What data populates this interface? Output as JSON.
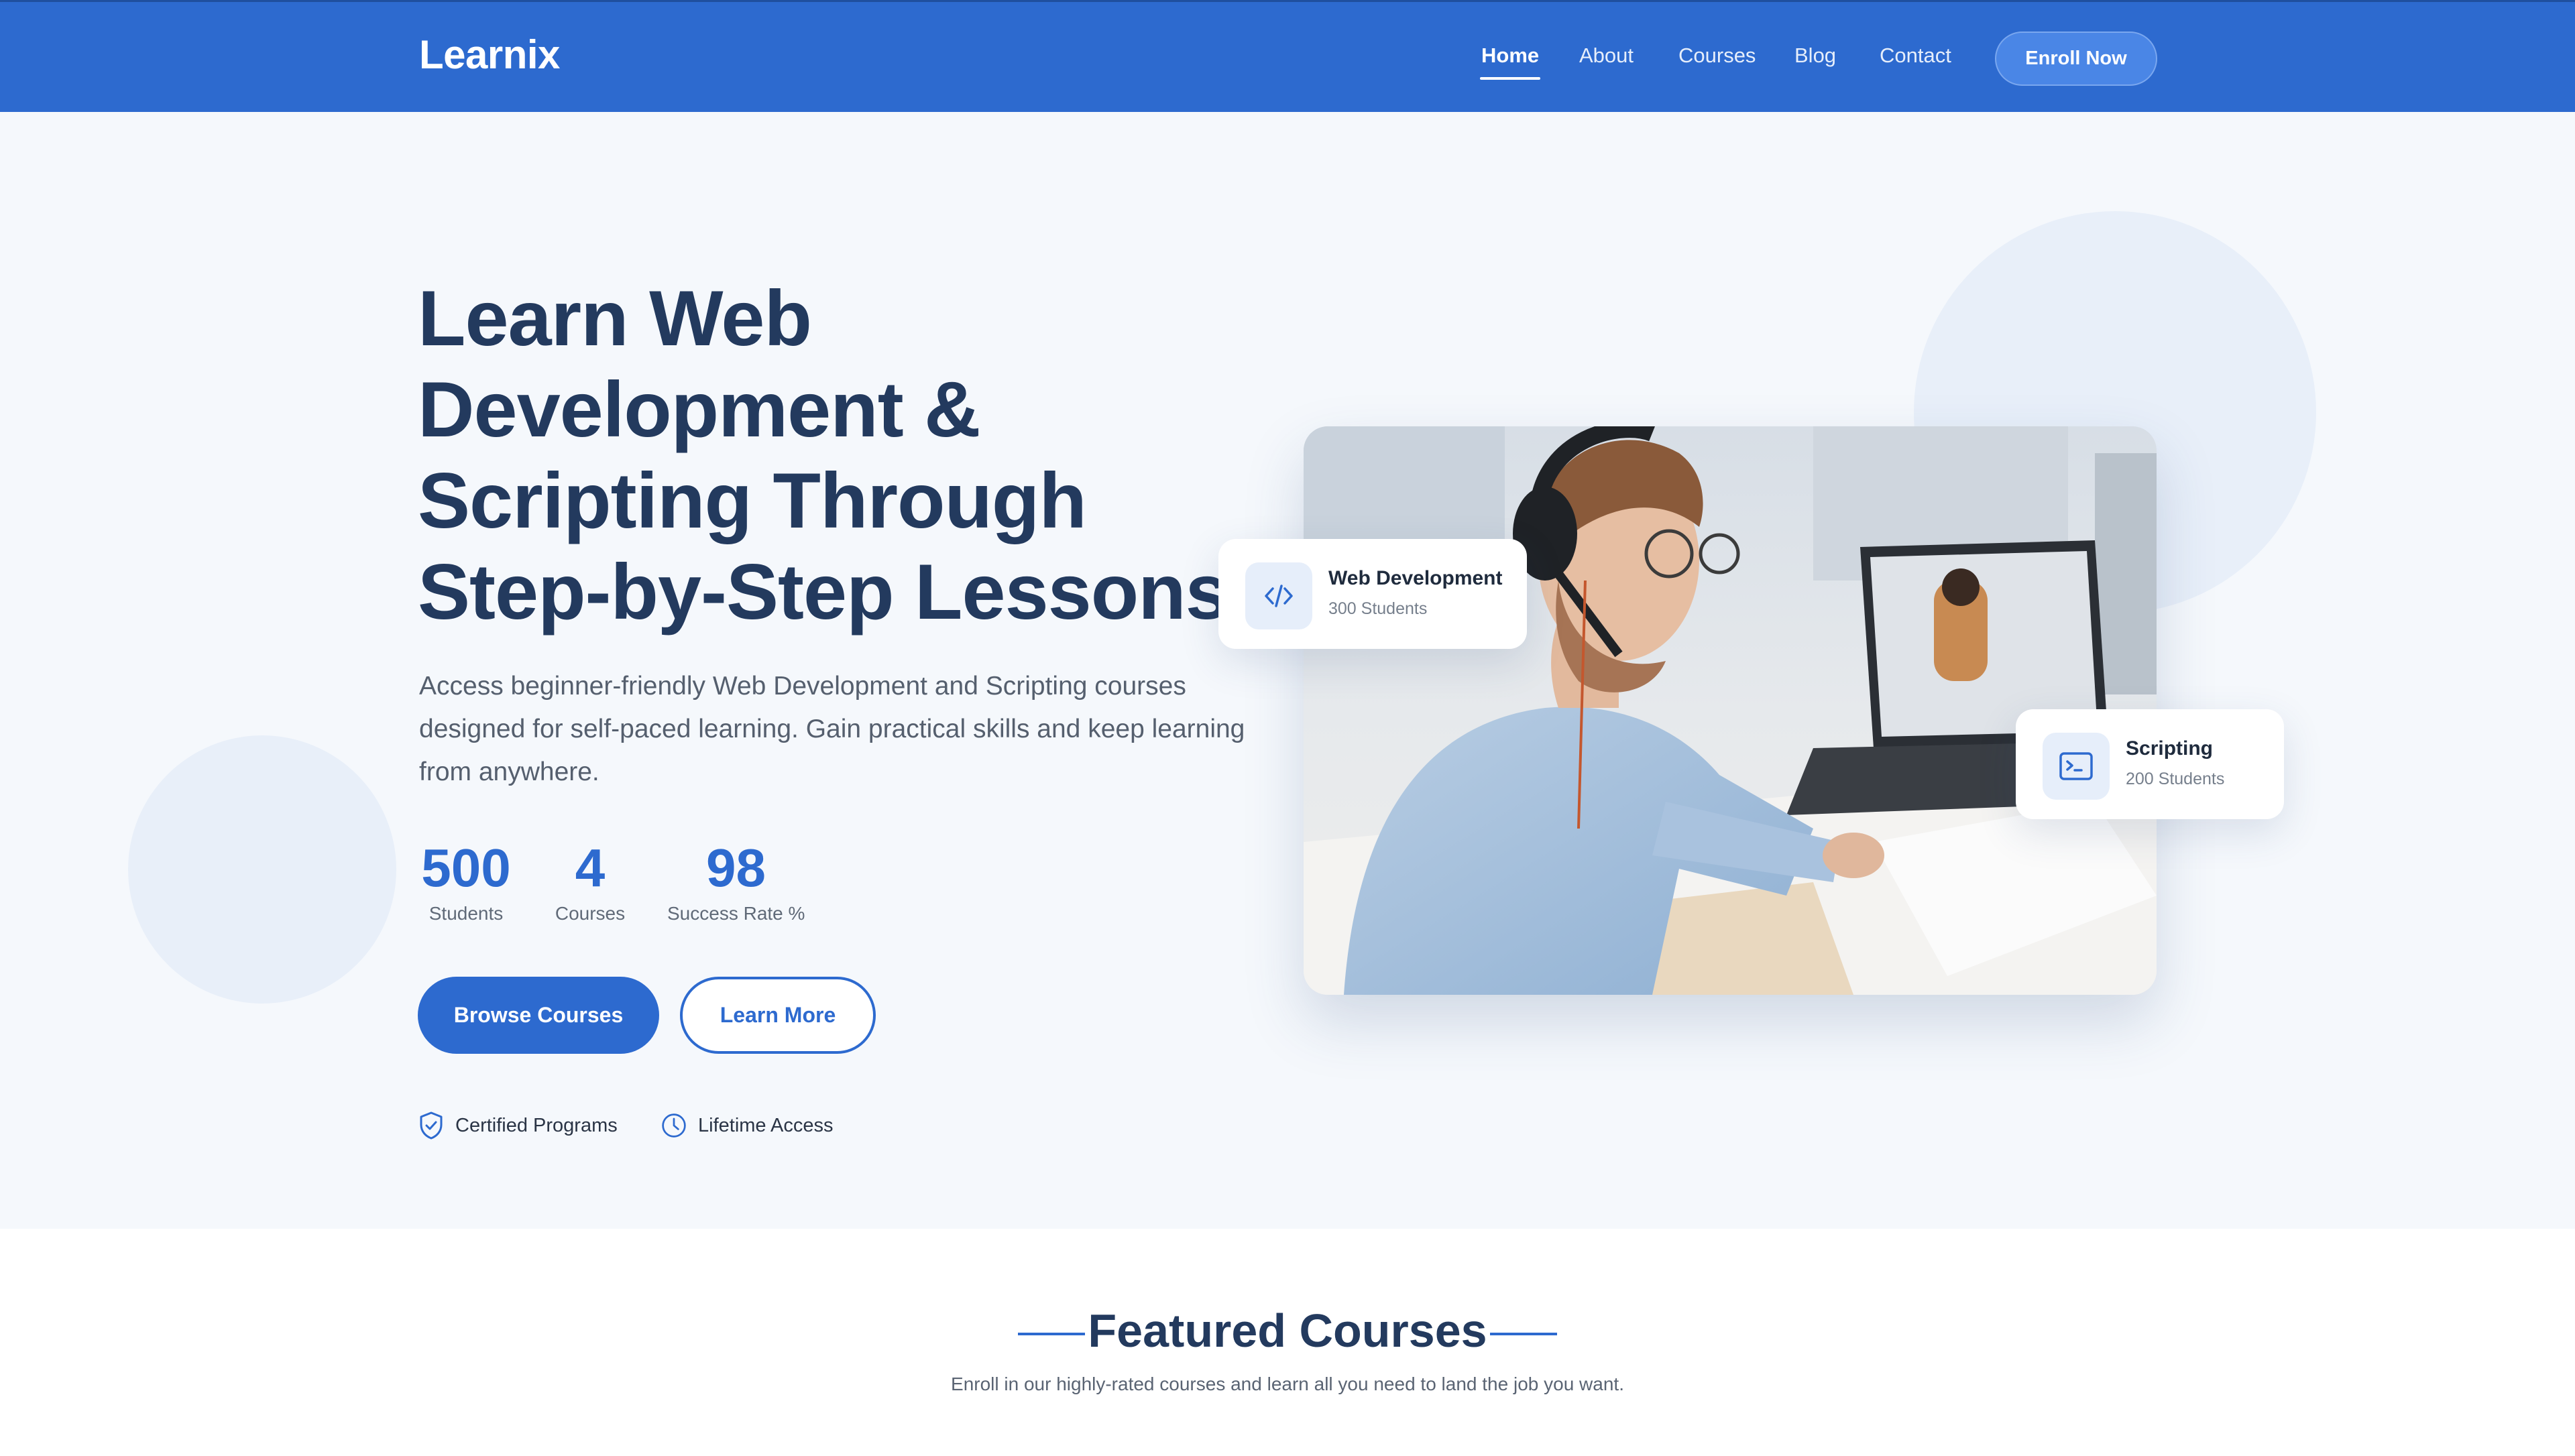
{
  "header": {
    "logo": "Learnix",
    "nav": [
      "Home",
      "About",
      "Courses",
      "Blog",
      "Contact"
    ],
    "active_nav": "Home",
    "cta": "Enroll Now"
  },
  "hero": {
    "title_lines": [
      "Learn Web",
      "Development &",
      "Scripting Through",
      "Step-by-Step Lessons"
    ],
    "description": "Access beginner-friendly Web Development and Scripting courses designed for self-paced learning. Gain practical skills and keep learning from anywhere.",
    "stats": [
      {
        "value": "500",
        "label": "Students"
      },
      {
        "value": "4",
        "label": "Courses"
      },
      {
        "value": "98",
        "label": "Success Rate %"
      }
    ],
    "primary_button": "Browse Courses",
    "secondary_button": "Learn More",
    "features": [
      {
        "label": "Certified Programs",
        "icon": "shield-check-icon"
      },
      {
        "label": "Lifetime Access",
        "icon": "clock-icon"
      }
    ],
    "cards": [
      {
        "title": "Web Development",
        "subtitle": "300 Students",
        "icon": "code-icon"
      },
      {
        "title": "Scripting",
        "subtitle": "200 Students",
        "icon": "terminal-icon"
      }
    ]
  },
  "featured": {
    "title": "Featured Courses",
    "subtitle": "Enroll in our highly-rated courses and learn all you need to land the job you want."
  },
  "colors": {
    "primary": "#2d6acf",
    "heading": "#233a5e",
    "background": "#f5f8fc"
  }
}
